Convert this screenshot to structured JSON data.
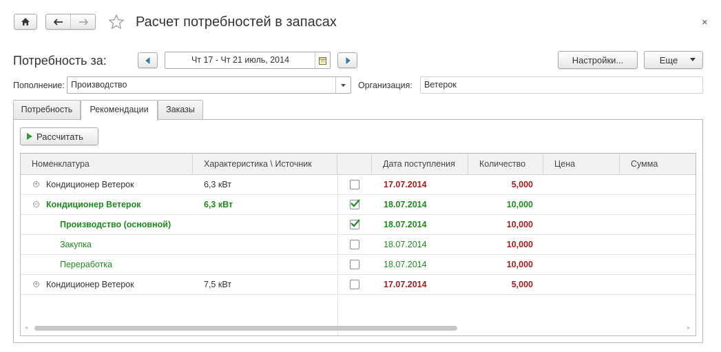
{
  "window": {
    "title": "Расчет потребностей в запасах",
    "close_label": "×"
  },
  "header": {
    "period_label": "Потребность за:",
    "period_value": "Чт 17 - Чт 21 июль, 2014",
    "settings_label": "Настройки...",
    "more_label": "Еще"
  },
  "filters": {
    "replenishment_label": "Пополнение:",
    "replenishment_value": "Производство",
    "organization_label": "Организация:",
    "organization_value": "Ветерок"
  },
  "tabs": [
    {
      "label": "Потребность",
      "active": false
    },
    {
      "label": "Рекомендации",
      "active": true
    },
    {
      "label": "Заказы",
      "active": false
    }
  ],
  "toolbar": {
    "calculate_label": "Рассчитать"
  },
  "grid": {
    "columns": [
      "Номенклатура",
      "Характеристика \\ Источник",
      "",
      "Дата поступления",
      "Количество",
      "Цена",
      "Сумма"
    ],
    "rows": [
      {
        "name": "Кондиционер Ветерок",
        "characteristic": "6,3 кВт",
        "checked": false,
        "date": "17.07.2014",
        "quantity": "5,000",
        "expander": "plus",
        "level": 0
      },
      {
        "name": "Кондиционер Ветерок",
        "characteristic": "6,3 кВт",
        "checked": true,
        "date": "18.07.2014",
        "quantity": "10,000",
        "expander": "minus",
        "level": 0
      },
      {
        "name": "Производство (основной)",
        "characteristic": "",
        "checked": true,
        "date": "18.07.2014",
        "quantity": "10,000",
        "expander": "none",
        "level": 1
      },
      {
        "name": "Закупка",
        "characteristic": "",
        "checked": false,
        "date": "18.07.2014",
        "quantity": "10,000",
        "expander": "none",
        "level": 1
      },
      {
        "name": "Переработка",
        "characteristic": "",
        "checked": false,
        "date": "18.07.2014",
        "quantity": "10,000",
        "expander": "none",
        "level": 1
      },
      {
        "name": "Кондиционер Ветерок",
        "characteristic": "7,5 кВт",
        "checked": false,
        "date": "17.07.2014",
        "quantity": "5,000",
        "expander": "plus",
        "level": 0
      }
    ]
  },
  "colors": {
    "selected_green": "#1e8a1e",
    "quantity_red": "#a01c1c",
    "date_dark_red": "#a01c1c"
  }
}
